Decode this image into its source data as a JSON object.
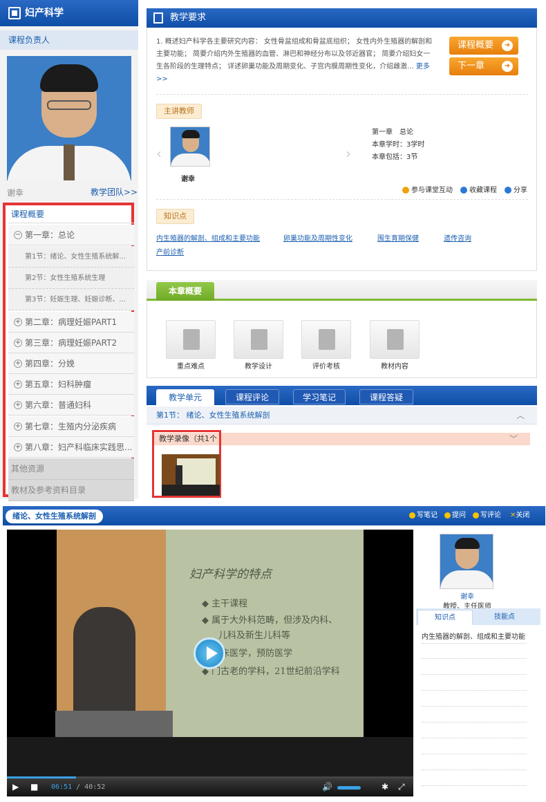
{
  "left": {
    "title": "妇产科学",
    "owner_label": "课程负责人",
    "teacher_name": "谢幸",
    "team_link": "教学团队>>",
    "nav_header": "课程概要",
    "chapter1": "第一章：总论",
    "sections": [
      "第1节：绪论、女性生殖系统解...",
      "第2节：女性生殖系统生理",
      "第3节：妊娠生理、妊娠诊断、..."
    ],
    "chapters": [
      "第二章：病理妊娠PART1",
      "第三章：病理妊娠PART2",
      "第四章：分娩",
      "第五章：妇科肿瘤",
      "第六章：普通妇科",
      "第七章：生殖内分泌疾病",
      "第八章：妇产科临床实践思..."
    ],
    "other_resources": "其他资源",
    "materials": "教材及参考资料目录"
  },
  "requirements": {
    "title": "教学要求",
    "text": "1. 概述妇产科学各主要研究内容： 女性骨盆组成和骨盆底组织； 女性内外生殖器的解剖和主要功能； 简要介绍内外生殖器的血管、淋巴和神经分布以及邻近器官； 简要介绍妇女一生各阶段的生理特点； 详述卵巢功能及周期变化、子宫内膜周期性变化，介绍雌激...",
    "more": "更多>>",
    "btn_overview": "课程概要",
    "btn_next": "下一章",
    "lecturer_tag": "主讲教师",
    "lecturer_name": "谢幸",
    "chapter_title": "第一章　总论",
    "chapter_hours": "本章学时：3学时",
    "chapter_includes": "本章包括：3节",
    "action_interact": "参与课堂互动",
    "action_collect": "收藏课程",
    "action_share": "分享",
    "kp_tag": "知识点",
    "knowledge_points": [
      "内生殖器的解剖、组成和主要功能",
      "卵巢功能及周期性变化",
      "围生育期保健",
      "遗传咨询",
      "产前诊断"
    ]
  },
  "overview": {
    "tab": "本章概要",
    "tools": [
      "重点难点",
      "教学设计",
      "评价考核",
      "教材内容"
    ]
  },
  "units": {
    "tabs": [
      "教学单元",
      "课程评论",
      "学习笔记",
      "课程答疑"
    ],
    "section": "第1节： 绪论、女性生殖系统解剖",
    "video_header": "教学录像（共1个"
  },
  "player": {
    "title": "绪论、女性生殖系统解剖",
    "tool_note": "写笔记",
    "tool_ask": "提问",
    "tool_comment": "写评论",
    "tool_close": "关闭",
    "slide_title": "妇产科学的特点",
    "slide_lines": [
      "◆ 主干课程",
      "◆ 属于大外科范畴，但涉及内科、",
      "儿科及新生儿科等",
      "◆ 临床医学，预防医学",
      "◆ 门古老的学科，21世纪前沿学科"
    ],
    "time_current": "06:51",
    "time_sep": " / ",
    "time_total": "40:52",
    "progress": 0.17,
    "volume": 0.85,
    "teacher_name": "谢幸",
    "teacher_title": "教授、主任医师",
    "side_tabs": [
      "知识点",
      "技能点"
    ],
    "side_kp": "内生殖器的解剖、组成和主要功能"
  }
}
